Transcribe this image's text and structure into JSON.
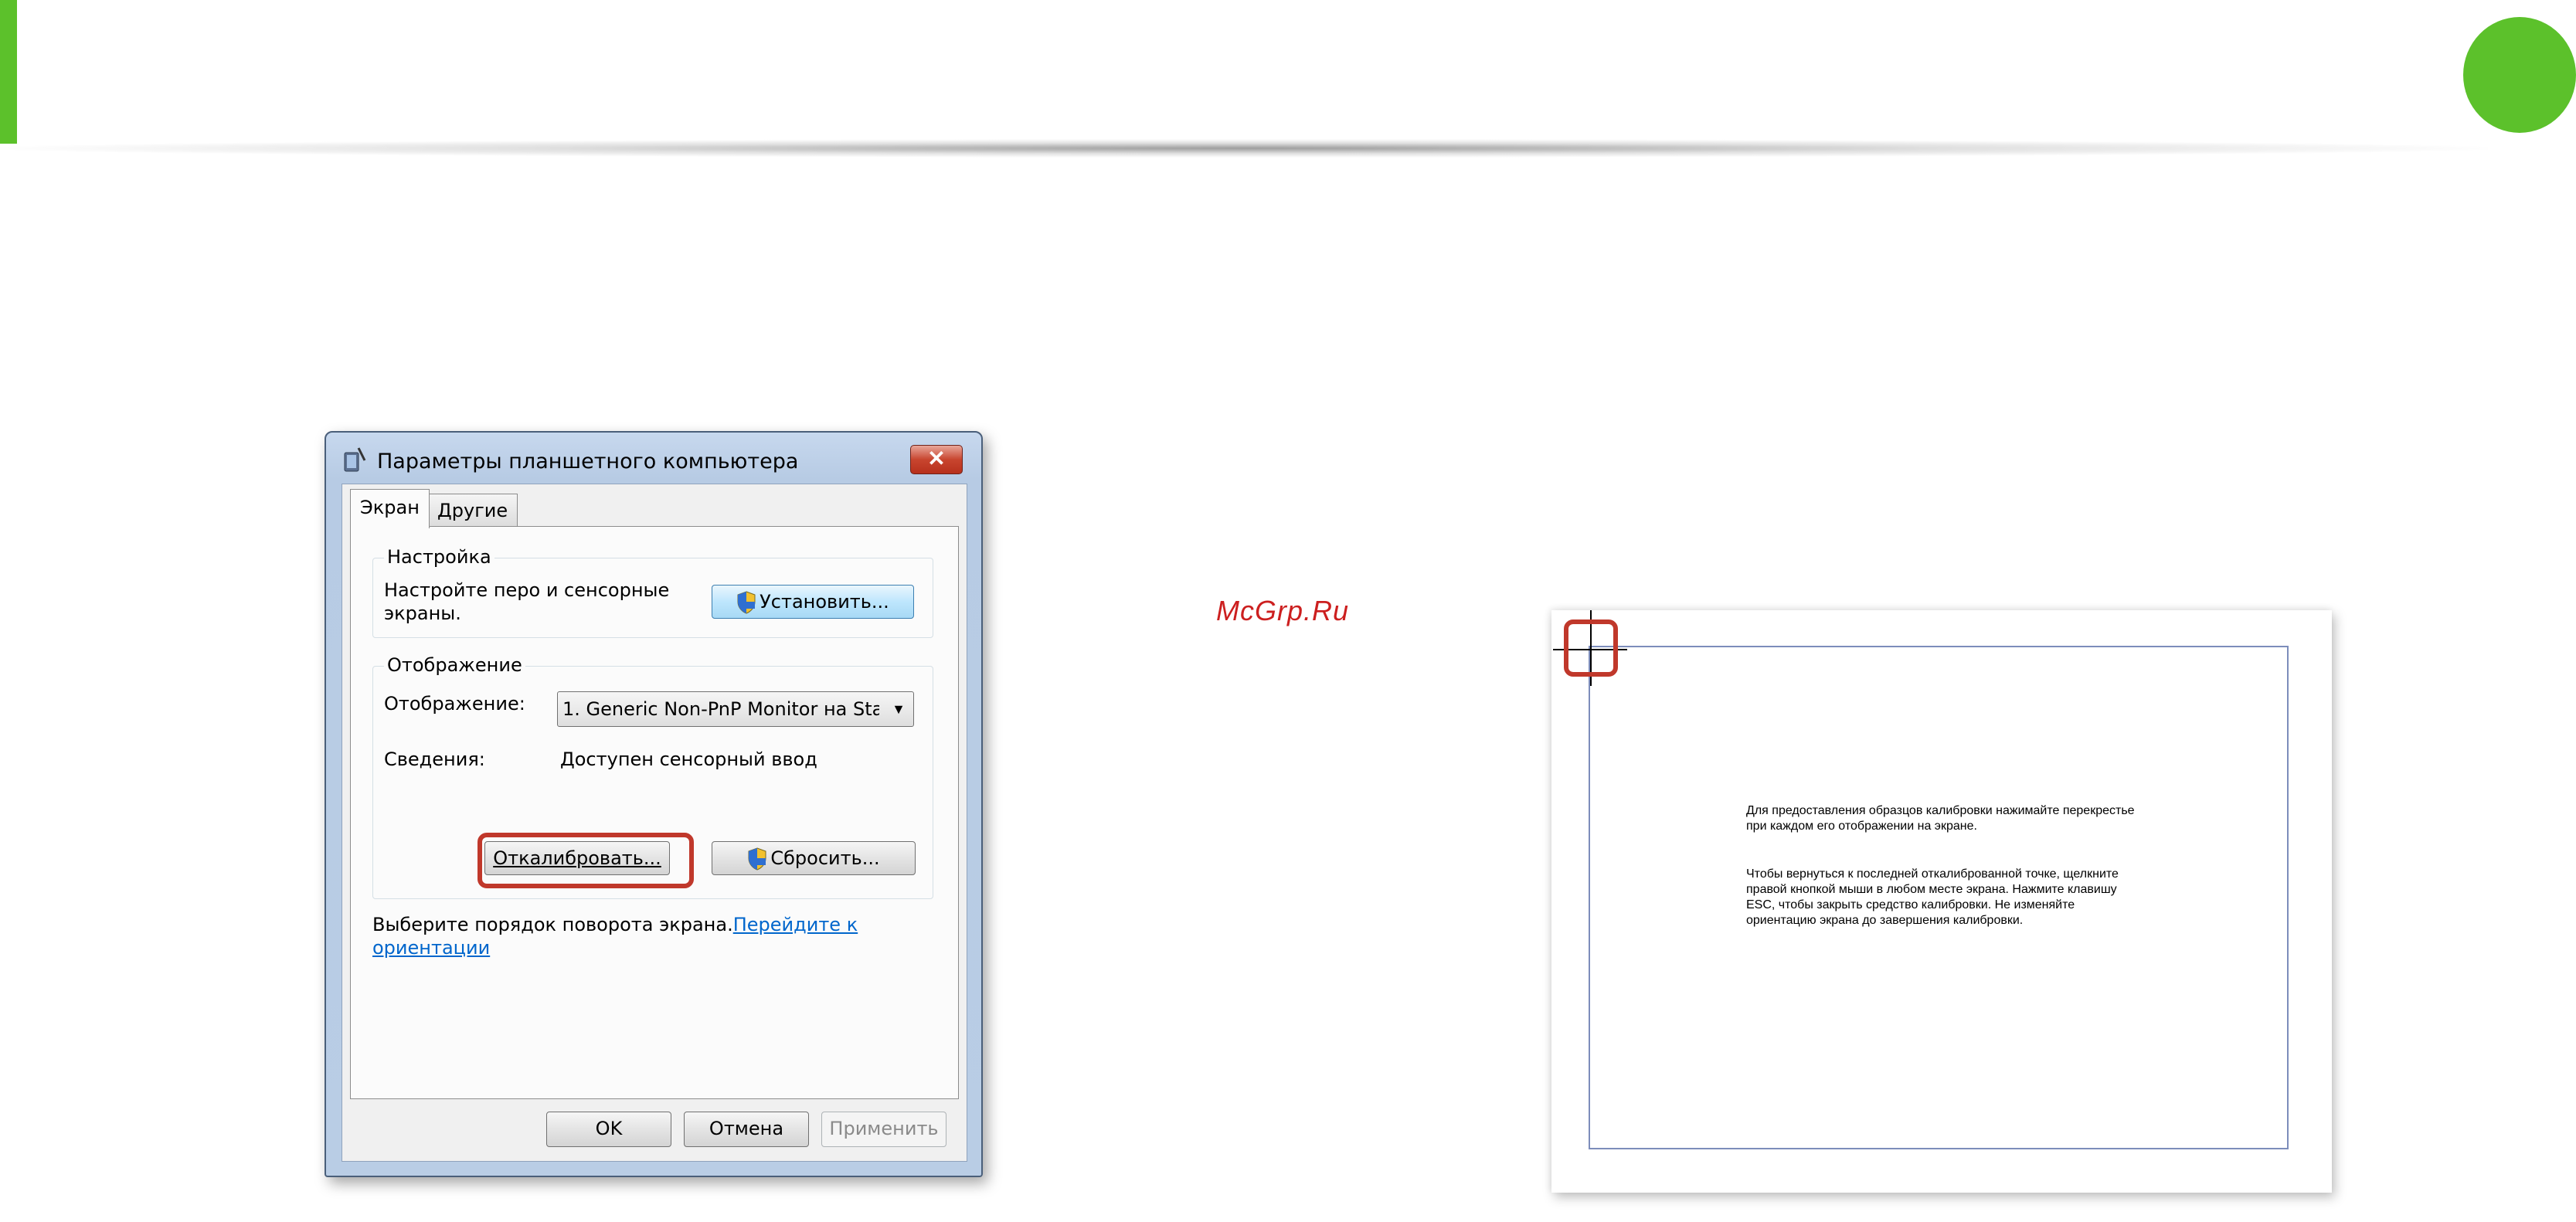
{
  "page": {
    "watermark": "McGrp.Ru",
    "accent_color": "#5cc12b",
    "highlight_color": "#c0382b"
  },
  "dialog": {
    "title": "Параметры планшетного компьютера",
    "close_label": "✕",
    "tabs": [
      {
        "label": "Экран"
      },
      {
        "label": "Другие"
      }
    ],
    "setup_group": {
      "title": "Настройка",
      "description": "Настройте перо и сенсорные экраны.",
      "button": "Установить..."
    },
    "display_group": {
      "title": "Отображение",
      "display_label": "Отображение:",
      "display_value": "1. Generic Non-PnP Monitor на Sta",
      "info_label": "Сведения:",
      "info_value": "Доступен сенсорный ввод",
      "calibrate_button": "Откалибровать...",
      "reset_button": "Сбросить..."
    },
    "rotation_text": "Выберите порядок поворота экрана.",
    "rotation_link": "Перейдите к ориентации",
    "buttons": {
      "ok": "OK",
      "cancel": "Отмена",
      "apply": "Применить"
    }
  },
  "calibration": {
    "paragraph1": "Для предоставления образцов калибровки нажимайте перекрестье при каждом его отображении на экране.",
    "paragraph2": "Чтобы вернуться к последней откалиброванной точке, щелкните правой кнопкой мыши в любом месте экрана. Нажмите клавишу ESC, чтобы закрыть средство калибровки. Не изменяйте ориентацию экрана до завершения калибровки."
  }
}
